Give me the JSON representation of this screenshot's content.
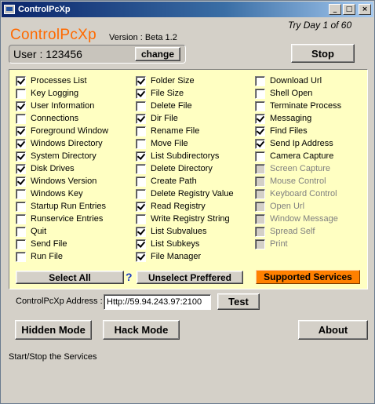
{
  "window": {
    "title": "ControlPcXp",
    "minimize": "_",
    "maximize": "□",
    "close": "×"
  },
  "header": {
    "brand": "ControlPcXp",
    "version": "Version : Beta 1.2",
    "trial": "Try Day 1 of 60",
    "user_text": "User : 123456",
    "change_label": "change",
    "stop_label": "Stop"
  },
  "services": {
    "col1": [
      {
        "label": "Processes List",
        "checked": true
      },
      {
        "label": "Key Logging",
        "checked": false
      },
      {
        "label": "User Information",
        "checked": true
      },
      {
        "label": "Connections",
        "checked": false
      },
      {
        "label": "Foreground Window",
        "checked": true
      },
      {
        "label": "Windows Directory",
        "checked": true
      },
      {
        "label": "System Directory",
        "checked": true
      },
      {
        "label": "Disk Drives",
        "checked": true
      },
      {
        "label": "Windows Version",
        "checked": true
      },
      {
        "label": "Windows Key",
        "checked": false
      },
      {
        "label": "Startup Run Entries",
        "checked": false
      },
      {
        "label": "Runservice Entries",
        "checked": false
      },
      {
        "label": "Quit",
        "checked": false
      },
      {
        "label": "Send File",
        "checked": false
      },
      {
        "label": "Run File",
        "checked": false
      }
    ],
    "col2": [
      {
        "label": "Folder Size",
        "checked": true
      },
      {
        "label": "File Size",
        "checked": true
      },
      {
        "label": "Delete File",
        "checked": false
      },
      {
        "label": "Dir File",
        "checked": true
      },
      {
        "label": "Rename File",
        "checked": false
      },
      {
        "label": "Move File",
        "checked": false
      },
      {
        "label": "List Subdirectorys",
        "checked": true
      },
      {
        "label": "Delete Directory",
        "checked": false
      },
      {
        "label": "Create Path",
        "checked": false
      },
      {
        "label": "Delete Registry Value",
        "checked": false
      },
      {
        "label": "Read Registry",
        "checked": true
      },
      {
        "label": "Write Registry String",
        "checked": false
      },
      {
        "label": "List Subvalues",
        "checked": true
      },
      {
        "label": "List Subkeys",
        "checked": true
      },
      {
        "label": "File Manager",
        "checked": true
      }
    ],
    "col3": [
      {
        "label": "Download Url",
        "checked": false,
        "disabled": false
      },
      {
        "label": "Shell Open",
        "checked": false,
        "disabled": false
      },
      {
        "label": "Terminate Process",
        "checked": false,
        "disabled": false
      },
      {
        "label": "Messaging",
        "checked": true,
        "disabled": false
      },
      {
        "label": "Find Files",
        "checked": true,
        "disabled": false
      },
      {
        "label": "Send Ip Address",
        "checked": true,
        "disabled": false
      },
      {
        "label": "Camera Capture",
        "checked": false,
        "disabled": false
      },
      {
        "label": "Screen Capture",
        "checked": false,
        "disabled": true
      },
      {
        "label": "Mouse Control",
        "checked": false,
        "disabled": true
      },
      {
        "label": "Keyboard Control",
        "checked": false,
        "disabled": true
      },
      {
        "label": "Open Url",
        "checked": false,
        "disabled": true
      },
      {
        "label": "Window Message",
        "checked": false,
        "disabled": true
      },
      {
        "label": "Spread Self",
        "checked": false,
        "disabled": true
      },
      {
        "label": "Print",
        "checked": false,
        "disabled": true
      }
    ],
    "select_all_label": "Select All",
    "help_mark": "?",
    "unselect_label": "Unselect Preffered",
    "supported_label": "Supported Services"
  },
  "address": {
    "label": "ControlPcXp Address :",
    "value": "Http://59.94.243.97:2100",
    "test_label": "Test"
  },
  "footer": {
    "hidden_mode": "Hidden Mode",
    "hack_mode": "Hack Mode",
    "about": "About",
    "status": "Start/Stop the Services"
  },
  "colors": {
    "panel_bg": "#ffffc2",
    "brand": "#ff6a00",
    "accent_button": "#ff8000"
  }
}
